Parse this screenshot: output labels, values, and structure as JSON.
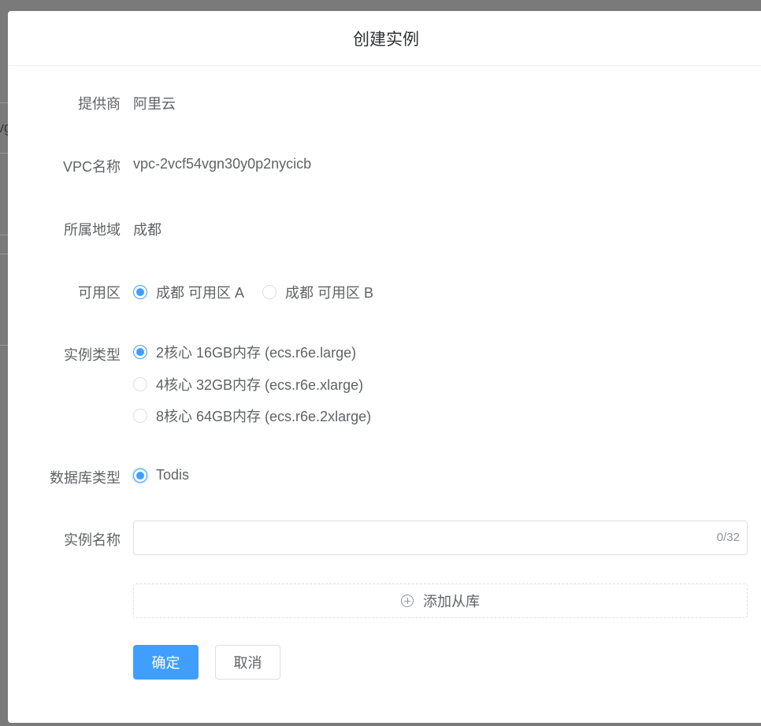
{
  "background": {
    "partial_text": "vg"
  },
  "dialog": {
    "title": "创建实例"
  },
  "form": {
    "provider": {
      "label": "提供商",
      "value": "阿里云"
    },
    "vpc": {
      "label": "VPC名称",
      "value": "vpc-2vcf54vgn30y0p2nycicb"
    },
    "region": {
      "label": "所属地域",
      "value": "成都"
    },
    "zone": {
      "label": "可用区",
      "options": [
        "成都 可用区 A",
        "成都 可用区 B"
      ],
      "selected": "成都 可用区 A"
    },
    "instance_type": {
      "label": "实例类型",
      "options": [
        "2核心 16GB内存 (ecs.r6e.large)",
        "4核心 32GB内存 (ecs.r6e.xlarge)",
        "8核心 64GB内存 (ecs.r6e.2xlarge)"
      ],
      "selected": "2核心 16GB内存 (ecs.r6e.large)"
    },
    "db_type": {
      "label": "数据库类型",
      "options": [
        "Todis"
      ],
      "selected": "Todis"
    },
    "instance_name": {
      "label": "实例名称",
      "value": "",
      "placeholder": "",
      "counter": "0/32"
    },
    "add_slave_label": "添加从库",
    "confirm_label": "确定",
    "cancel_label": "取消"
  },
  "colors": {
    "primary": "#409eff",
    "text": "#606266",
    "title": "#303133",
    "border": "#dcdfe6"
  }
}
